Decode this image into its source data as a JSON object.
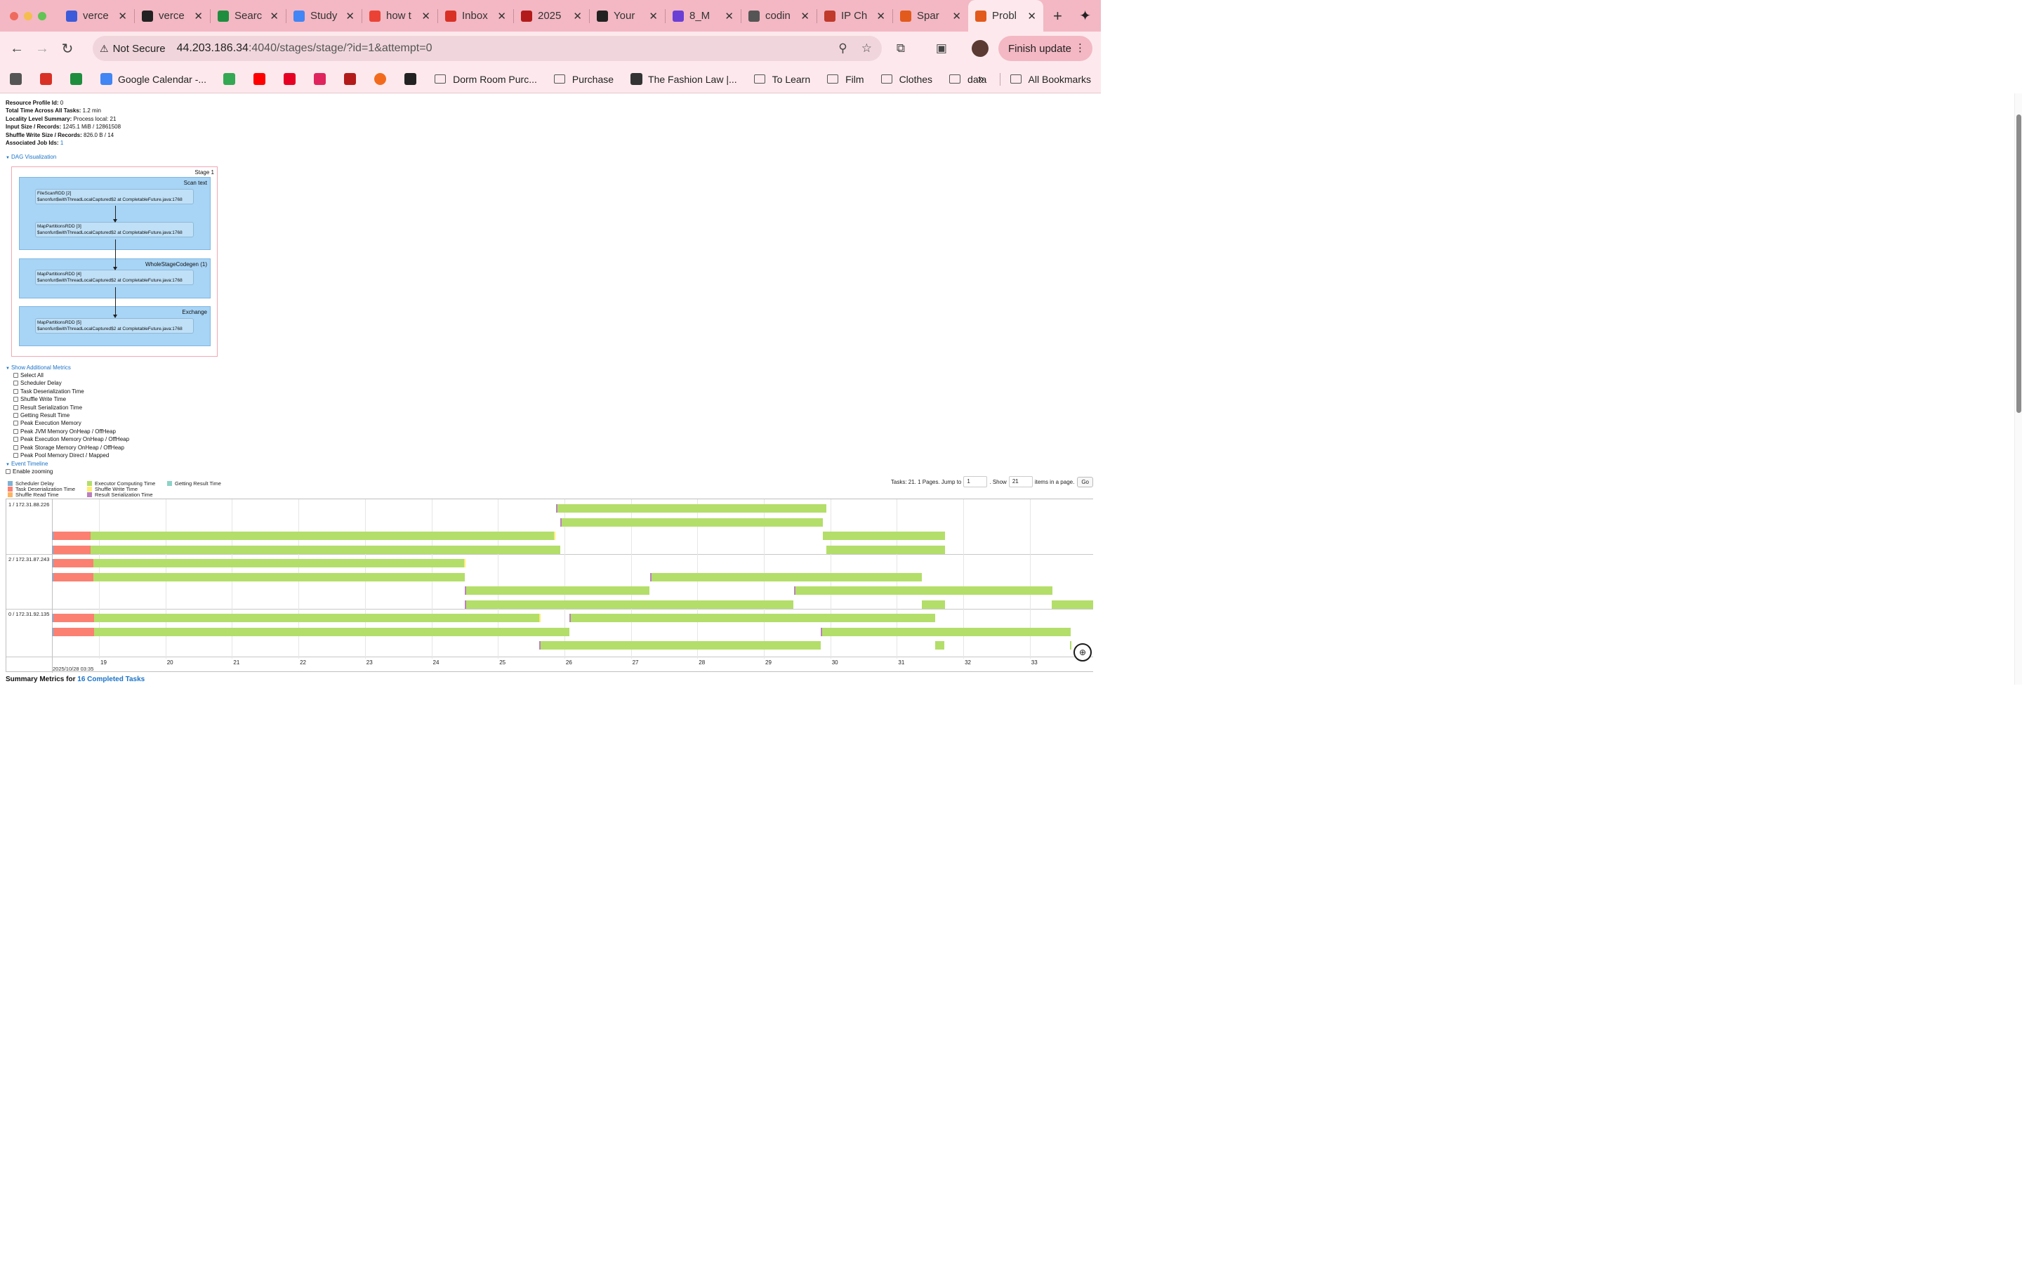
{
  "browser": {
    "tabs": [
      {
        "label": "verce",
        "icon": "vercel-icon",
        "color": "#3b5bdb"
      },
      {
        "label": "verce",
        "icon": "github-icon",
        "color": "#222222"
      },
      {
        "label": "Searc",
        "icon": "google-drive-icon",
        "color": "#1e8e3e"
      },
      {
        "label": "Study",
        "icon": "google-docs-icon",
        "color": "#4285f4"
      },
      {
        "label": "how t",
        "icon": "google-icon",
        "color": "#ea4335"
      },
      {
        "label": "Inbox",
        "icon": "gmail-icon",
        "color": "#d93025"
      },
      {
        "label": "2025",
        "icon": "pdf-icon",
        "color": "#b31b1b"
      },
      {
        "label": "Your",
        "icon": "github-icon",
        "color": "#222222"
      },
      {
        "label": "8_M",
        "icon": "k-icon",
        "color": "#6a3fd6"
      },
      {
        "label": "codin",
        "icon": "openai-icon",
        "color": "#555555"
      },
      {
        "label": "IP Ch",
        "icon": "horse-icon",
        "color": "#c0392b"
      },
      {
        "label": "Spar",
        "icon": "spark-icon",
        "color": "#e25a1c"
      },
      {
        "label": "Probl",
        "icon": "spark-icon",
        "color": "#e25a1c"
      }
    ],
    "security_label": "Not Secure",
    "url_host": "44.203.186.34",
    "url_rest": ":4040/stages/stage/?id=1&attempt=0",
    "finish_update": "Finish update",
    "bookmarks": [
      {
        "label": "",
        "icon": "apps-grid-icon"
      },
      {
        "label": "",
        "icon": "gmail-icon"
      },
      {
        "label": "",
        "icon": "google-drive-icon"
      },
      {
        "label": "Google Calendar -...",
        "icon": "calendar-icon"
      },
      {
        "label": "",
        "icon": "maps-icon"
      },
      {
        "label": "",
        "icon": "youtube-icon"
      },
      {
        "label": "",
        "icon": "pinterest-icon"
      },
      {
        "label": "",
        "icon": "gift-icon"
      },
      {
        "label": "",
        "icon": "pdf-icon"
      },
      {
        "label": "",
        "icon": "orange-circle-icon"
      },
      {
        "label": "",
        "icon": "amazon-icon"
      },
      {
        "label": "Dorm Room Purc...",
        "icon": "folder-icon"
      },
      {
        "label": "Purchase",
        "icon": "folder-icon"
      },
      {
        "label": "The Fashion Law |...",
        "icon": "tfl-icon"
      },
      {
        "label": "To Learn",
        "icon": "folder-icon"
      },
      {
        "label": "Film",
        "icon": "folder-icon"
      },
      {
        "label": "Clothes",
        "icon": "folder-icon"
      },
      {
        "label": "data",
        "icon": "folder-icon"
      }
    ],
    "all_bookmarks": "All Bookmarks"
  },
  "stage": {
    "details": [
      {
        "label": "Resource Profile Id:",
        "value": " 0"
      },
      {
        "label": "Total Time Across All Tasks:",
        "value": " 1.2 min"
      },
      {
        "label": "Locality Level Summary:",
        "value": " Process local: 21"
      },
      {
        "label": "Input Size / Records:",
        "value": " 1245.1 MiB / 12861508"
      },
      {
        "label": "Shuffle Write Size / Records:",
        "value": " 826.0 B / 14"
      },
      {
        "label": "Associated Job Ids:",
        "value": " ",
        "link": "1"
      }
    ],
    "dag_toggle": "DAG Visualization",
    "dag": {
      "stage_label": "Stage 1",
      "clusters": [
        {
          "label": "Scan text",
          "rdds": [
            {
              "name": "FileScanRDD [2]",
              "callsite": "$anonfun$withThreadLocalCaptured$2 at CompletableFuture.java:1768"
            },
            {
              "name": "MapPartitionsRDD [3]",
              "callsite": "$anonfun$withThreadLocalCaptured$2 at CompletableFuture.java:1768"
            }
          ]
        },
        {
          "label": "WholeStageCodegen (1)",
          "rdds": [
            {
              "name": "MapPartitionsRDD [4]",
              "callsite": "$anonfun$withThreadLocalCaptured$2 at CompletableFuture.java:1768"
            }
          ]
        },
        {
          "label": "Exchange",
          "rdds": [
            {
              "name": "MapPartitionsRDD [5]",
              "callsite": "$anonfun$withThreadLocalCaptured$2 at CompletableFuture.java:1768"
            }
          ]
        }
      ]
    },
    "metrics_toggle": "Show Additional Metrics",
    "metrics": [
      "Select All",
      "Scheduler Delay",
      "Task Deserialization Time",
      "Shuffle Write Time",
      "Result Serialization Time",
      "Getting Result Time",
      "Peak Execution Memory",
      "Peak JVM Memory OnHeap / OffHeap",
      "Peak Execution Memory OnHeap / OffHeap",
      "Peak Storage Memory OnHeap / OffHeap",
      "Peak Pool Memory Direct / Mapped"
    ],
    "timeline_toggle": "Event Timeline",
    "enable_zooming": "Enable zooming",
    "legend": [
      {
        "label": "Scheduler Delay",
        "color": "#80b1d3"
      },
      {
        "label": "Task Deserialization Time",
        "color": "#fb8072"
      },
      {
        "label": "Shuffle Read Time",
        "color": "#fdb462"
      },
      {
        "label": "Executor Computing Time",
        "color": "#b3de69"
      },
      {
        "label": "Shuffle Write Time",
        "color": "#ffed6f"
      },
      {
        "label": "Result Serialization Time",
        "color": "#bc80bd"
      },
      {
        "label": "Getting Result Time",
        "color": "#8dd3c7"
      }
    ],
    "pager": {
      "prefix": "Tasks: 21. 1 Pages. Jump to",
      "page": "1",
      "show": ". Show",
      "count": "21",
      "suffix": "items in a page.",
      "go": "Go"
    },
    "executors": [
      "1 / 172.31.88.226",
      "2 / 172.31.87.243",
      "0 / 172.31.92.135"
    ],
    "ticks": [
      "19",
      "20",
      "21",
      "22",
      "23",
      "24",
      "25",
      "26",
      "27",
      "28",
      "29",
      "30",
      "31",
      "32",
      "33"
    ],
    "date_label": "2025/10/28 03:35",
    "summary_prefix": "Summary Metrics for ",
    "summary_link": "16 Completed Tasks"
  }
}
